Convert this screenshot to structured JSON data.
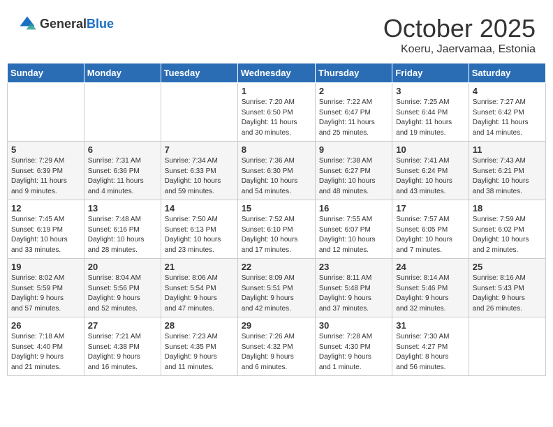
{
  "header": {
    "logo_general": "General",
    "logo_blue": "Blue",
    "month": "October 2025",
    "location": "Koeru, Jaervamaa, Estonia"
  },
  "days_of_week": [
    "Sunday",
    "Monday",
    "Tuesday",
    "Wednesday",
    "Thursday",
    "Friday",
    "Saturday"
  ],
  "weeks": [
    [
      {
        "day": "",
        "info": ""
      },
      {
        "day": "",
        "info": ""
      },
      {
        "day": "",
        "info": ""
      },
      {
        "day": "1",
        "info": "Sunrise: 7:20 AM\nSunset: 6:50 PM\nDaylight: 11 hours\nand 30 minutes."
      },
      {
        "day": "2",
        "info": "Sunrise: 7:22 AM\nSunset: 6:47 PM\nDaylight: 11 hours\nand 25 minutes."
      },
      {
        "day": "3",
        "info": "Sunrise: 7:25 AM\nSunset: 6:44 PM\nDaylight: 11 hours\nand 19 minutes."
      },
      {
        "day": "4",
        "info": "Sunrise: 7:27 AM\nSunset: 6:42 PM\nDaylight: 11 hours\nand 14 minutes."
      }
    ],
    [
      {
        "day": "5",
        "info": "Sunrise: 7:29 AM\nSunset: 6:39 PM\nDaylight: 11 hours\nand 9 minutes."
      },
      {
        "day": "6",
        "info": "Sunrise: 7:31 AM\nSunset: 6:36 PM\nDaylight: 11 hours\nand 4 minutes."
      },
      {
        "day": "7",
        "info": "Sunrise: 7:34 AM\nSunset: 6:33 PM\nDaylight: 10 hours\nand 59 minutes."
      },
      {
        "day": "8",
        "info": "Sunrise: 7:36 AM\nSunset: 6:30 PM\nDaylight: 10 hours\nand 54 minutes."
      },
      {
        "day": "9",
        "info": "Sunrise: 7:38 AM\nSunset: 6:27 PM\nDaylight: 10 hours\nand 48 minutes."
      },
      {
        "day": "10",
        "info": "Sunrise: 7:41 AM\nSunset: 6:24 PM\nDaylight: 10 hours\nand 43 minutes."
      },
      {
        "day": "11",
        "info": "Sunrise: 7:43 AM\nSunset: 6:21 PM\nDaylight: 10 hours\nand 38 minutes."
      }
    ],
    [
      {
        "day": "12",
        "info": "Sunrise: 7:45 AM\nSunset: 6:19 PM\nDaylight: 10 hours\nand 33 minutes."
      },
      {
        "day": "13",
        "info": "Sunrise: 7:48 AM\nSunset: 6:16 PM\nDaylight: 10 hours\nand 28 minutes."
      },
      {
        "day": "14",
        "info": "Sunrise: 7:50 AM\nSunset: 6:13 PM\nDaylight: 10 hours\nand 23 minutes."
      },
      {
        "day": "15",
        "info": "Sunrise: 7:52 AM\nSunset: 6:10 PM\nDaylight: 10 hours\nand 17 minutes."
      },
      {
        "day": "16",
        "info": "Sunrise: 7:55 AM\nSunset: 6:07 PM\nDaylight: 10 hours\nand 12 minutes."
      },
      {
        "day": "17",
        "info": "Sunrise: 7:57 AM\nSunset: 6:05 PM\nDaylight: 10 hours\nand 7 minutes."
      },
      {
        "day": "18",
        "info": "Sunrise: 7:59 AM\nSunset: 6:02 PM\nDaylight: 10 hours\nand 2 minutes."
      }
    ],
    [
      {
        "day": "19",
        "info": "Sunrise: 8:02 AM\nSunset: 5:59 PM\nDaylight: 9 hours\nand 57 minutes."
      },
      {
        "day": "20",
        "info": "Sunrise: 8:04 AM\nSunset: 5:56 PM\nDaylight: 9 hours\nand 52 minutes."
      },
      {
        "day": "21",
        "info": "Sunrise: 8:06 AM\nSunset: 5:54 PM\nDaylight: 9 hours\nand 47 minutes."
      },
      {
        "day": "22",
        "info": "Sunrise: 8:09 AM\nSunset: 5:51 PM\nDaylight: 9 hours\nand 42 minutes."
      },
      {
        "day": "23",
        "info": "Sunrise: 8:11 AM\nSunset: 5:48 PM\nDaylight: 9 hours\nand 37 minutes."
      },
      {
        "day": "24",
        "info": "Sunrise: 8:14 AM\nSunset: 5:46 PM\nDaylight: 9 hours\nand 32 minutes."
      },
      {
        "day": "25",
        "info": "Sunrise: 8:16 AM\nSunset: 5:43 PM\nDaylight: 9 hours\nand 26 minutes."
      }
    ],
    [
      {
        "day": "26",
        "info": "Sunrise: 7:18 AM\nSunset: 4:40 PM\nDaylight: 9 hours\nand 21 minutes."
      },
      {
        "day": "27",
        "info": "Sunrise: 7:21 AM\nSunset: 4:38 PM\nDaylight: 9 hours\nand 16 minutes."
      },
      {
        "day": "28",
        "info": "Sunrise: 7:23 AM\nSunset: 4:35 PM\nDaylight: 9 hours\nand 11 minutes."
      },
      {
        "day": "29",
        "info": "Sunrise: 7:26 AM\nSunset: 4:32 PM\nDaylight: 9 hours\nand 6 minutes."
      },
      {
        "day": "30",
        "info": "Sunrise: 7:28 AM\nSunset: 4:30 PM\nDaylight: 9 hours\nand 1 minute."
      },
      {
        "day": "31",
        "info": "Sunrise: 7:30 AM\nSunset: 4:27 PM\nDaylight: 8 hours\nand 56 minutes."
      },
      {
        "day": "",
        "info": ""
      }
    ]
  ]
}
